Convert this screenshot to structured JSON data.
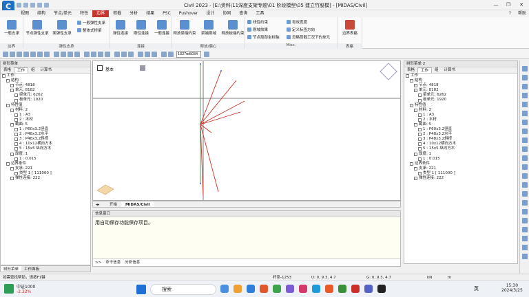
{
  "window": {
    "title": "Civil 2023 - [E:\\资料\\11深度支架专题\\01 阶段模型\\05 建立竹股模] - [MIDAS/Civil]",
    "minimize": "—",
    "maximize": "❐",
    "close": "✕"
  },
  "menu": {
    "tabs": [
      "视图",
      "结构",
      "节点/单元",
      "特性",
      "边界",
      "荷载",
      "分析",
      "结果",
      "PSC",
      "Pushover",
      "设计",
      "协同",
      "查询",
      "工具"
    ],
    "active": "边界",
    "right": [
      "?",
      "帮助"
    ]
  },
  "ribbon": {
    "groups": [
      {
        "name": "边界",
        "buttons": [
          "一般支承"
        ]
      },
      {
        "name": "弹性支承",
        "buttons": [
          "节点弹性支承",
          "面弹性支承"
        ],
        "small": [
          "一般弹性支承",
          "整体式桥梁"
        ]
      },
      {
        "name": "连接",
        "buttons": [
          "弹性连接",
          "刚性连接",
          "一般连接"
        ]
      },
      {
        "name": "释放/偏心",
        "buttons": [
          "释放梁端约束",
          "梁端刚域",
          "释放板端约束"
        ]
      },
      {
        "name": "Misc.",
        "small": [
          "线性约束",
          "刚域效果",
          "节点局部坐标轴",
          "有效宽度",
          "定义标签方向",
          "忽略荷载工况下的单元"
        ]
      },
      {
        "name": "表格",
        "buttons": [
          "边界表格"
        ]
      }
    ]
  },
  "toolbar": {
    "node_input": "1327to5034"
  },
  "left_panel": {
    "title": "树形菜单",
    "tabs": [
      "表格",
      "工作",
      "组",
      "计算书"
    ],
    "active_tab": "工作",
    "tree": [
      "工作",
      "结构",
      "节点: 4818",
      "单元: 8182",
      "梁单元: 6262",
      "板单元: 1920",
      "特性值",
      "材料: 2",
      "1 : A3",
      "2 : 木材",
      "截面: 5",
      "1 : P60x3.2竖直",
      "2 : P48x3.2水平",
      "3 : P48x3.2斜撑",
      "4 : 10x12横向方木",
      "5 : 15x5 纵向方木",
      "厚度: 1",
      "1 : 0.015",
      "边界条件",
      "支承: 221",
      "类型 1 [ 111000 ]",
      "弹性连接: 222"
    ],
    "bottom_tabs": [
      "树形菜单",
      "工作面板"
    ]
  },
  "right_panel": {
    "title": "树形菜单 2",
    "tabs": [
      "表格",
      "工作",
      "组",
      "计算书"
    ],
    "active_tab": "工作",
    "tree": [
      "工作",
      "结构",
      "节点: 4818",
      "单元: 8182",
      "梁单元: 6262",
      "板单元: 1920",
      "特性值",
      "材料: 2",
      "1 : A3",
      "2 : 木材",
      "截面: 5",
      "1 : P60x3.2竖直",
      "2 : P48x3.2水平",
      "3 : P48x3.2斜撑",
      "4 : 10x12横向方木",
      "5 : 15x5 纵向方木",
      "厚度: 1",
      "1 : 0.015",
      "边界条件",
      "支承: 221",
      "类型 1 [ 111000 ]",
      "弹性连接: 222"
    ]
  },
  "viewport": {
    "label": "基本"
  },
  "doc_tabs": [
    "开始",
    "MIDAS/Civil"
  ],
  "message": {
    "title": "信息窗口",
    "text": "用自动保存功能保存项目。",
    "cmd_tabs": [
      "命令信息",
      "分析信息"
    ],
    "prompt": ">>"
  },
  "status": {
    "help": "如需查找帮助，请按F1键",
    "frame": "杆系-1253",
    "coord1": "U: 0, 9.3, 4.7",
    "coord2": "G: 0, 9.3, 4.7",
    "unit1": "kN",
    "unit2": "m"
  },
  "taskbar": {
    "stock_name": "中证1000",
    "stock_change": "-2.32%",
    "search_placeholder": "搜索",
    "time": "15:30",
    "date": "2024/3/25",
    "lang": "英"
  }
}
